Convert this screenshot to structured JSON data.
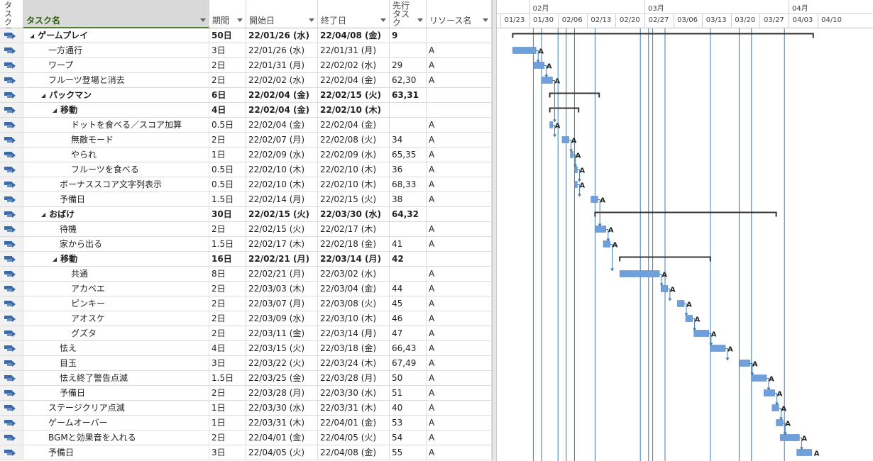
{
  "headers": {
    "mode": "タスクモード",
    "name": "タスク名",
    "duration": "期間",
    "start": "開始日",
    "end": "終了日",
    "predecessors": "先行タスク",
    "resource": "リソース名"
  },
  "tasks": [
    {
      "name": "ゲームプレイ",
      "level": 1,
      "summary": true,
      "duration": "50日",
      "start": "22/01/26 (水)",
      "end": "22/04/08 (金)",
      "pred": "9",
      "res": ""
    },
    {
      "name": "一方通行",
      "level": 2,
      "summary": false,
      "duration": "3日",
      "start": "22/01/26 (水)",
      "end": "22/01/31 (月)",
      "pred": "",
      "res": "A"
    },
    {
      "name": "ワープ",
      "level": 2,
      "summary": false,
      "duration": "2日",
      "start": "22/01/31 (月)",
      "end": "22/02/02 (水)",
      "pred": "29",
      "res": "A"
    },
    {
      "name": "フルーツ登場と消去",
      "level": 2,
      "summary": false,
      "duration": "2日",
      "start": "22/02/02 (水)",
      "end": "22/02/04 (金)",
      "pred": "62,30",
      "res": "A"
    },
    {
      "name": "パックマン",
      "level": 2,
      "summary": true,
      "duration": "6日",
      "start": "22/02/04 (金)",
      "end": "22/02/15 (火)",
      "pred": "63,31",
      "res": ""
    },
    {
      "name": "移動",
      "level": 3,
      "summary": true,
      "duration": "4日",
      "start": "22/02/04 (金)",
      "end": "22/02/10 (木)",
      "pred": "",
      "res": ""
    },
    {
      "name": "ドットを食べる／スコア加算",
      "level": 4,
      "summary": false,
      "duration": "0.5日",
      "start": "22/02/04 (金)",
      "end": "22/02/04 (金)",
      "pred": "",
      "res": "A"
    },
    {
      "name": "無敵モード",
      "level": 4,
      "summary": false,
      "duration": "2日",
      "start": "22/02/07 (月)",
      "end": "22/02/08 (火)",
      "pred": "34",
      "res": "A"
    },
    {
      "name": "やられ",
      "level": 4,
      "summary": false,
      "duration": "1日",
      "start": "22/02/09 (水)",
      "end": "22/02/09 (水)",
      "pred": "65,35",
      "res": "A"
    },
    {
      "name": "フルーツを食べる",
      "level": 4,
      "summary": false,
      "duration": "0.5日",
      "start": "22/02/10 (木)",
      "end": "22/02/10 (木)",
      "pred": "36",
      "res": "A"
    },
    {
      "name": "ボーナススコア文字列表示",
      "level": 3,
      "summary": false,
      "duration": "0.5日",
      "start": "22/02/10 (木)",
      "end": "22/02/10 (木)",
      "pred": "68,33",
      "res": "A"
    },
    {
      "name": "予備日",
      "level": 3,
      "summary": false,
      "duration": "1.5日",
      "start": "22/02/14 (月)",
      "end": "22/02/15 (火)",
      "pred": "38",
      "res": "A"
    },
    {
      "name": "おばけ",
      "level": 2,
      "summary": true,
      "duration": "30日",
      "start": "22/02/15 (火)",
      "end": "22/03/30 (水)",
      "pred": "64,32",
      "res": ""
    },
    {
      "name": "待機",
      "level": 3,
      "summary": false,
      "duration": "2日",
      "start": "22/02/15 (火)",
      "end": "22/02/17 (木)",
      "pred": "",
      "res": "A"
    },
    {
      "name": "家から出る",
      "level": 3,
      "summary": false,
      "duration": "1.5日",
      "start": "22/02/17 (木)",
      "end": "22/02/18 (金)",
      "pred": "41",
      "res": "A"
    },
    {
      "name": "移動",
      "level": 3,
      "summary": true,
      "duration": "16日",
      "start": "22/02/21 (月)",
      "end": "22/03/14 (月)",
      "pred": "42",
      "res": ""
    },
    {
      "name": "共通",
      "level": 4,
      "summary": false,
      "duration": "8日",
      "start": "22/02/21 (月)",
      "end": "22/03/02 (水)",
      "pred": "",
      "res": "A"
    },
    {
      "name": "アカベエ",
      "level": 4,
      "summary": false,
      "duration": "2日",
      "start": "22/03/03 (木)",
      "end": "22/03/04 (金)",
      "pred": "44",
      "res": "A"
    },
    {
      "name": "ピンキー",
      "level": 4,
      "summary": false,
      "duration": "2日",
      "start": "22/03/07 (月)",
      "end": "22/03/08 (火)",
      "pred": "45",
      "res": "A"
    },
    {
      "name": "アオスケ",
      "level": 4,
      "summary": false,
      "duration": "2日",
      "start": "22/03/09 (水)",
      "end": "22/03/10 (木)",
      "pred": "46",
      "res": "A"
    },
    {
      "name": "グズタ",
      "level": 4,
      "summary": false,
      "duration": "2日",
      "start": "22/03/11 (金)",
      "end": "22/03/14 (月)",
      "pred": "47",
      "res": "A"
    },
    {
      "name": "怯え",
      "level": 3,
      "summary": false,
      "duration": "4日",
      "start": "22/03/15 (火)",
      "end": "22/03/18 (金)",
      "pred": "66,43",
      "res": "A"
    },
    {
      "name": "目玉",
      "level": 3,
      "summary": false,
      "duration": "3日",
      "start": "22/03/22 (火)",
      "end": "22/03/24 (木)",
      "pred": "67,49",
      "res": "A"
    },
    {
      "name": "怯え終了警告点滅",
      "level": 3,
      "summary": false,
      "duration": "1.5日",
      "start": "22/03/25 (金)",
      "end": "22/03/28 (月)",
      "pred": "50",
      "res": "A"
    },
    {
      "name": "予備日",
      "level": 3,
      "summary": false,
      "duration": "2日",
      "start": "22/03/28 (月)",
      "end": "22/03/30 (水)",
      "pred": "51",
      "res": "A"
    },
    {
      "name": "ステージクリア点滅",
      "level": 2,
      "summary": false,
      "duration": "1日",
      "start": "22/03/30 (水)",
      "end": "22/03/31 (木)",
      "pred": "40",
      "res": "A"
    },
    {
      "name": "ゲームオーバー",
      "level": 2,
      "summary": false,
      "duration": "1日",
      "start": "22/03/31 (木)",
      "end": "22/04/01 (金)",
      "pred": "53",
      "res": "A"
    },
    {
      "name": "BGMと効果音を入れる",
      "level": 2,
      "summary": false,
      "duration": "2日",
      "start": "22/04/01 (金)",
      "end": "22/04/05 (火)",
      "pred": "54",
      "res": "A"
    },
    {
      "name": "予備日",
      "level": 2,
      "summary": false,
      "duration": "3日",
      "start": "22/04/05 (火)",
      "end": "22/04/08 (金)",
      "pred": "55",
      "res": "A"
    }
  ],
  "timeline": {
    "months": [
      {
        "label": "02月",
        "start": "2022-01-30",
        "sep": "2022-01-30"
      },
      {
        "label": "03月",
        "start": "2022-02-27",
        "sep": "2022-02-27"
      },
      {
        "label": "04月",
        "start": "2022-04-03",
        "sep": "2022-04-03"
      }
    ],
    "weeks": [
      {
        "label": "01/23",
        "start": "2022-01-23"
      },
      {
        "label": "01/30",
        "start": "2022-01-30"
      },
      {
        "label": "02/06",
        "start": "2022-02-06"
      },
      {
        "label": "02/13",
        "start": "2022-02-13"
      },
      {
        "label": "02/20",
        "start": "2022-02-20"
      },
      {
        "label": "02/27",
        "start": "2022-02-27"
      },
      {
        "label": "03/06",
        "start": "2022-03-06"
      },
      {
        "label": "03/13",
        "start": "2022-03-13"
      },
      {
        "label": "03/20",
        "start": "2022-03-20"
      },
      {
        "label": "03/27",
        "start": "2022-03-27"
      },
      {
        "label": "04/03",
        "start": "2022-04-03"
      },
      {
        "label": "04/10",
        "start": "2022-04-10"
      }
    ],
    "vertical_markers": [
      "2022-01-31",
      "2022-02-02",
      "2022-02-06",
      "2022-02-08",
      "2022-02-10",
      "2022-02-15",
      "2022-02-26",
      "2022-02-28",
      "2022-03-01",
      "2022-03-04",
      "2022-03-15",
      "2022-03-22",
      "2022-03-25",
      "2022-04-02"
    ]
  },
  "colors": {
    "bar": "#6fa0dc",
    "bar_border": "#4a7fc0",
    "summary": "#333333",
    "link": "#222222",
    "marker": "#3f79ad",
    "name_header_bg": "#d9d9d9",
    "name_header_accent": "#2e5f10"
  }
}
